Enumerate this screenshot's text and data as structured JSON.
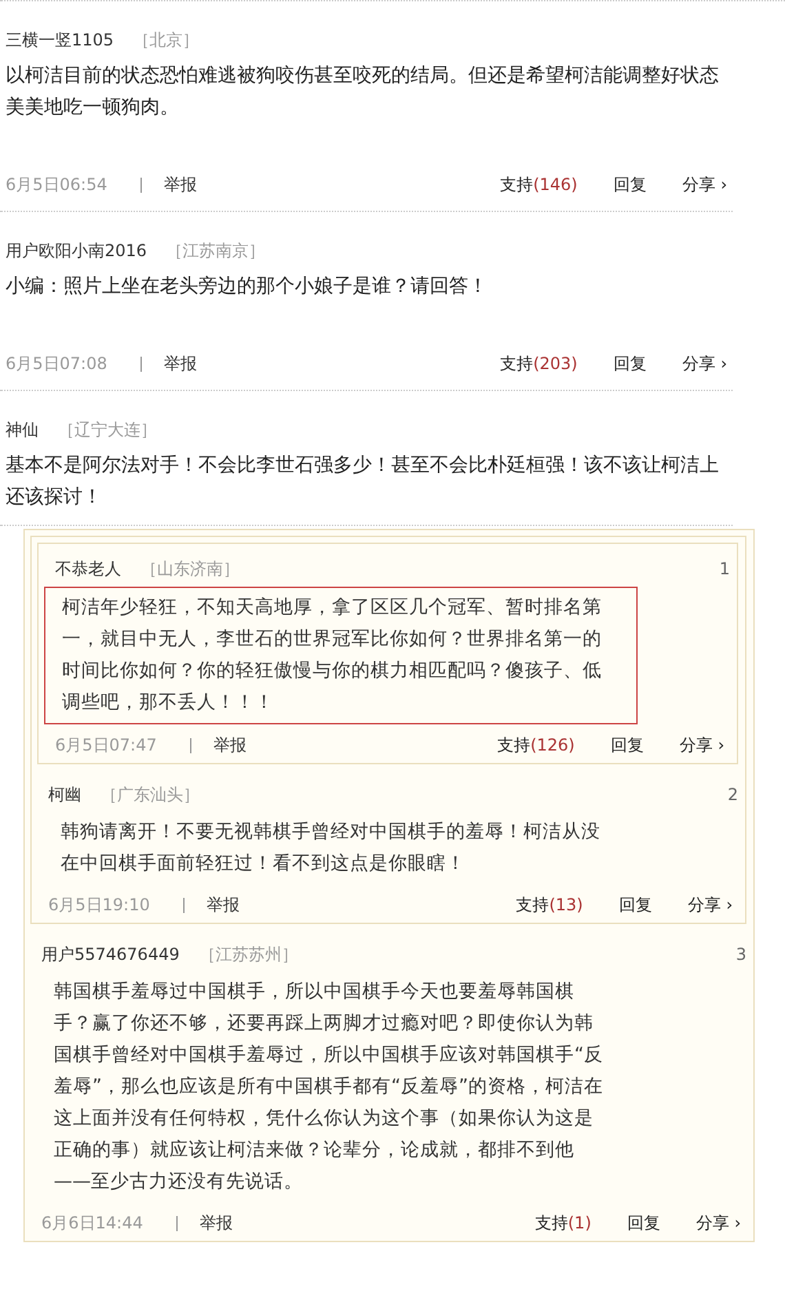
{
  "comments": [
    {
      "user": "三横一竖1105",
      "location": "［北京］",
      "text": "以柯洁目前的状态恐怕难逃被狗咬伤甚至咬死的结局。但还是希望柯洁能调整好状态美美地吃一顿狗肉。",
      "footer": {
        "date": "6月5日06:54",
        "report": "举报",
        "support": "支持",
        "count": "(146)",
        "reply": "回复",
        "share": "分享 ›"
      }
    },
    {
      "user": "用户欧阳小南2016",
      "location": "［江苏南京］",
      "text": "小编：照片上坐在老头旁边的那个小娘子是谁？请回答！",
      "footer": {
        "date": "6月5日07:08",
        "report": "举报",
        "support": "支持",
        "count": "(203)",
        "reply": "回复",
        "share": "分享 ›"
      }
    },
    {
      "user": "神仙",
      "location": "［辽宁大连］",
      "text": "基本不是阿尔法对手！不会比李世石强多少！甚至不会比朴廷桓强！该不该让柯洁上还该探讨！"
    }
  ],
  "thread": {
    "floor": "3",
    "user": "用户5574676449",
    "location": "［江苏苏州］",
    "highlighted": false,
    "text": "韩国棋手羞辱过中国棋手，所以中国棋手今天也要羞辱韩国棋手？赢了你还不够，还要再踩上两脚才过瘾对吧？即使你认为韩国棋手曾经对中国棋手羞辱过，所以中国棋手应该对韩国棋手“反羞辱”，那么也应该是所有中国棋手都有“反羞辱”的资格，柯洁在这上面并没有任何特权，凭什么你认为这个事（如果你认为这是正确的事）就应该让柯洁来做？论辈分，论成就，都排不到他——至少古力还没有先说话。",
    "footer": {
      "date": "6月6日14:44",
      "report": "举报",
      "support": "支持",
      "count": "(1)",
      "reply": "回复",
      "share": "分享 ›"
    },
    "quote": {
      "floor": "2",
      "user": "柯幽",
      "location": "［广东汕头］",
      "highlighted": false,
      "text": "韩狗请离开！不要无视韩棋手曾经对中国棋手的羞辱！柯洁从没在中回棋手面前轻狂过！看不到这点是你眼瞎！",
      "footer": {
        "date": "6月5日19:10",
        "report": "举报",
        "support": "支持",
        "count": "(13)",
        "reply": "回复",
        "share": "分享 ›"
      },
      "quote": {
        "floor": "1",
        "user": "不恭老人",
        "location": "［山东济南］",
        "highlighted": true,
        "text": "柯洁年少轻狂，不知天高地厚，拿了区区几个冠军、暂时排名第一，就目中无人，李世石的世界冠军比你如何？世界排名第一的时间比你如何？你的轻狂傲慢与你的棋力相匹配吗？傻孩子、低调些吧，那不丢人！！！",
        "footer": {
          "date": "6月5日07:47",
          "report": "举报",
          "support": "支持",
          "count": "(126)",
          "reply": "回复",
          "share": "分享 ›"
        }
      }
    }
  }
}
